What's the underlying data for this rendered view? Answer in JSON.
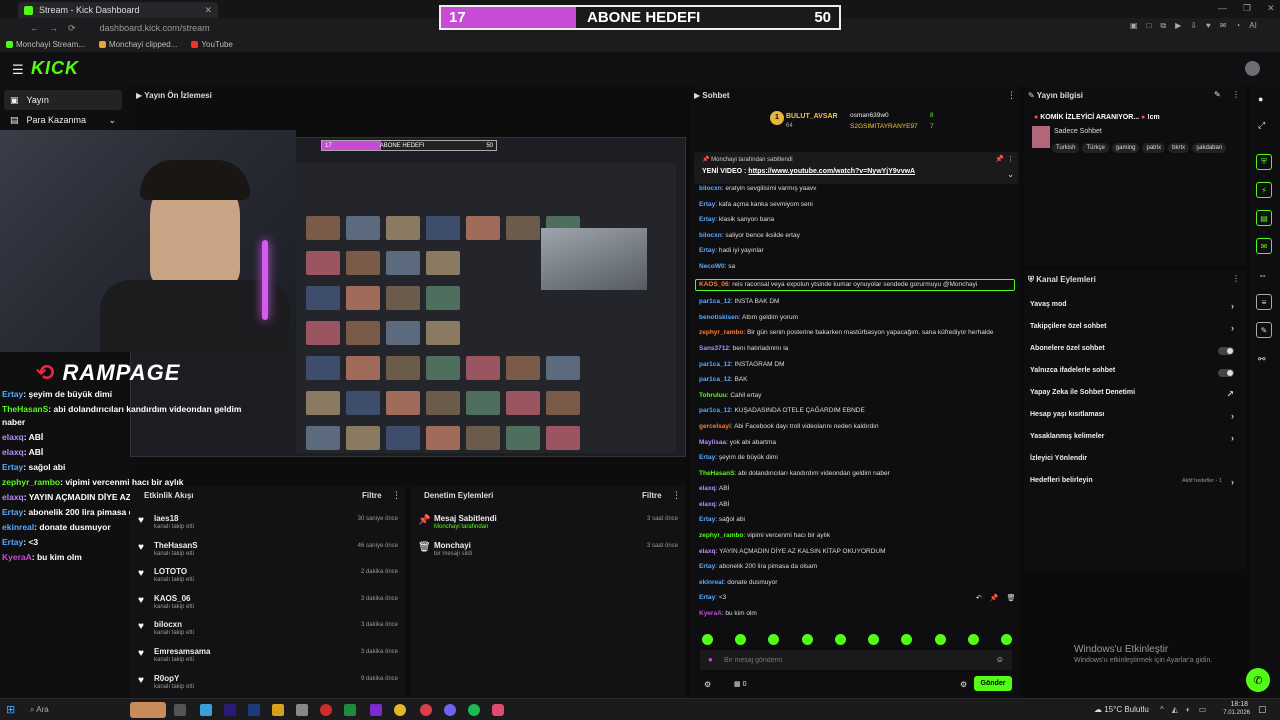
{
  "browser": {
    "tab_title": "Stream - Kick Dashboard",
    "url": "dashboard.kick.com/stream",
    "bookmarks": [
      "Monchayi Stream...",
      "Monchayi clipped...",
      "YouTube"
    ]
  },
  "goal_overlay": {
    "current": "17",
    "title": "ABONE HEDEFI",
    "target": "50",
    "progress": 0.34,
    "fill_color": "#c84bd6"
  },
  "kick": {
    "logo": "KICK",
    "brand_color": "#53fc18"
  },
  "sidebar": {
    "items": [
      {
        "label": "Yayın",
        "icon": "broadcast-icon"
      },
      {
        "label": "Para Kazanma",
        "icon": "money-icon"
      }
    ]
  },
  "preview": {
    "title": "Yayın Ön İzlemesi",
    "mini_goal_current": "17",
    "mini_goal_title": "ABONE HEDEFI",
    "mini_goal_target": "50",
    "rampage_logo": "RAMPAGE"
  },
  "overlay_chat": [
    {
      "name": "Ertay",
      "color": "#57a9ff",
      "text": "şeyim de büyük dimi"
    },
    {
      "name": "TheHasanS",
      "color": "#53fc18",
      "text": "abi dolandırıcıları kandırdım videondan geldim naber"
    },
    {
      "name": "elaxq",
      "color": "#b58bff",
      "text": "ABİ"
    },
    {
      "name": "elaxq",
      "color": "#b58bff",
      "text": "ABİ"
    },
    {
      "name": "Ertay",
      "color": "#57a9ff",
      "text": "sağol abi"
    },
    {
      "name": "zephyr_rambo",
      "color": "#53fc18",
      "text": "vipimi vercenmi hacı bir aylık"
    },
    {
      "name": "elaxq",
      "color": "#b58bff",
      "text": "YAYIN AÇMADIN DİYE AZ KALSIN KİTAP OKUYORDUM"
    },
    {
      "name": "Ertay",
      "color": "#57a9ff",
      "text": "abonelik 200 lira pimasa da olsam"
    },
    {
      "name": "ekinreal",
      "color": "#57a9ff",
      "text": "donate dusmuyor"
    },
    {
      "name": "Ertay",
      "color": "#57a9ff",
      "text": "<3"
    },
    {
      "name": "KyeraA",
      "color": "#c84bd6",
      "text": "bu kim olm"
    }
  ],
  "activity": {
    "title": "Etkinlik Akışı",
    "filter": "Filtre",
    "events": [
      {
        "name": "laes18",
        "sub": "kanalı takip etti",
        "time": "30 saniye önce"
      },
      {
        "name": "TheHasanS",
        "sub": "kanalı takip etti",
        "time": "46 saniye önce"
      },
      {
        "name": "LOTOTO",
        "sub": "kanalı takip etti",
        "time": "2 dakika önce"
      },
      {
        "name": "KAOS_06",
        "sub": "kanalı takip etti",
        "time": "3 dakika önce"
      },
      {
        "name": "bilocxn",
        "sub": "kanalı takip etti",
        "time": "3 dakika önce"
      },
      {
        "name": "Emresamsama",
        "sub": "kanalı takip etti",
        "time": "3 dakika önce"
      },
      {
        "name": "R0opY",
        "sub": "kanalı takip etti",
        "time": "9 dakika önce"
      }
    ]
  },
  "moderation": {
    "title": "Denetim Eylemleri",
    "filter": "Filtre",
    "events": [
      {
        "name": "Mesaj Sabitlendi",
        "sub": "Monchayi tarafından",
        "time": "3 saat önce"
      },
      {
        "name": "Monchayi",
        "sub": "bir mesajı sildi",
        "time": "3 saat önce"
      }
    ]
  },
  "chat": {
    "title": "Sohbet",
    "top_gifters": [
      {
        "name": "BULUT_AVSAR",
        "amount": "64"
      },
      {
        "name": "osman639w0",
        "amount": "8"
      },
      {
        "name": "S2GSIMITAYRANYE97",
        "amount": "7"
      }
    ],
    "pinned_by": "Monchayi tarafından sabitlendi",
    "pinned_text": "YENİ VIDEO : ",
    "pinned_link": "https://www.youtube.com/watch?v=NywYjY9vvwA",
    "messages": [
      {
        "name": "bilocxn",
        "color": "#57a9ff",
        "text": "eratyin sevgilisimi varmış yaavv"
      },
      {
        "name": "Ertay",
        "color": "#57a9ff",
        "text": "kafa açma kanka sevmiyom seni"
      },
      {
        "name": "Ertay",
        "color": "#57a9ff",
        "text": "klasik sanyon bana"
      },
      {
        "name": "bilocxn",
        "color": "#57a9ff",
        "text": "saliyor bence iksilde ertay"
      },
      {
        "name": "Ertay",
        "color": "#57a9ff",
        "text": "hadi iyi yayınlar"
      },
      {
        "name": "NecoW0",
        "color": "#57a9ff",
        "text": "sa"
      },
      {
        "name": "KAOS_06",
        "color": "#ff7a2e",
        "text": "reis raconsal veya expolun ytsinde kumar oynuyolar sendede gorurmuyu @Monchayi",
        "highlight": true
      },
      {
        "name": "par1ca_12",
        "color": "#57a9ff",
        "text": "INSTA BAK DM"
      },
      {
        "name": "benotiskisen",
        "color": "#57a9ff",
        "text": "Attım geldim yorum"
      },
      {
        "name": "zephyr_rambo",
        "color": "#ff7a2e",
        "text": "Bir gün senin posterine bakarken mastürbasyon yapacağım. sana küfrediyor herhalde"
      },
      {
        "name": "Sans3712",
        "color": "#b58bff",
        "text": "benı hatırladınmı la"
      },
      {
        "name": "par1ca_12",
        "color": "#57a9ff",
        "text": "INSTAGRAM DM"
      },
      {
        "name": "par1ca_12",
        "color": "#57a9ff",
        "text": "BAK"
      },
      {
        "name": "Tohruluu",
        "color": "#53fc18",
        "text": "Cahil ertay"
      },
      {
        "name": "par1ca_12",
        "color": "#57a9ff",
        "text": "KUŞADASINDA OTELE ÇAĞARDIM EBNDE"
      },
      {
        "name": "gercelsayi",
        "color": "#ff7a2e",
        "text": "Abi Facebook dayı troll videolarını neden kaldırdın"
      },
      {
        "name": "Maylisaa",
        "color": "#b58bff",
        "text": "yok abi abartma"
      },
      {
        "name": "Ertay",
        "color": "#57a9ff",
        "text": "şeyim de büyük dimi"
      },
      {
        "name": "TheHasanS",
        "color": "#53fc18",
        "text": "abi dolandırıcıları kandırdım videondan geldim naber"
      },
      {
        "name": "elaxq",
        "color": "#b58bff",
        "text": "ABİ"
      },
      {
        "name": "elaxq",
        "color": "#b58bff",
        "text": "ABİ"
      },
      {
        "name": "Ertay",
        "color": "#57a9ff",
        "text": "sağol abi"
      },
      {
        "name": "zephyr_rambo",
        "color": "#53fc18",
        "text": "vipimi vercenmi hacı bir aylık"
      },
      {
        "name": "elaxq",
        "color": "#b58bff",
        "text": "YAYIN AÇMADIN DİYE AZ KALSIN KİTAP OKUYORDUM"
      },
      {
        "name": "Ertay",
        "color": "#57a9ff",
        "text": "abonelik 200 lira pimasa da olsam"
      },
      {
        "name": "ekinreal",
        "color": "#57a9ff",
        "text": "donate dusmuyor"
      },
      {
        "name": "Ertay",
        "color": "#57a9ff",
        "text": "<3"
      },
      {
        "name": "KyeraA",
        "color": "#c84bd6",
        "text": "bu kim olm"
      }
    ],
    "input_placeholder": "Bir mesaj gönderin",
    "send_label": "Gönder",
    "viewer_count": "0"
  },
  "stream_info": {
    "title": "Yayın bilgisi",
    "stream_title": "KOMİK İZLEYİCİ ARANIYOR...",
    "stream_title_suffix": "!cm",
    "category": "Sadece Sohbet",
    "tags": [
      "Turkish",
      "Türkçe",
      "gaming",
      "patrix",
      "bkrtx",
      "şakdaban"
    ]
  },
  "channel_actions": {
    "title": "Kanal Eylemleri",
    "items": [
      {
        "label": "Yavaş mod",
        "kind": "chevron"
      },
      {
        "label": "Takipçilere özel sohbet",
        "kind": "chevron"
      },
      {
        "label": "Abonelere özel sohbet",
        "kind": "toggle"
      },
      {
        "label": "Yalnızca ifadelerle sohbet",
        "kind": "toggle"
      },
      {
        "label": "Yapay Zeka ile Sohbet Denetimi",
        "kind": "external"
      },
      {
        "label": "Hesap yaşı kısıtlaması",
        "kind": "chevron"
      },
      {
        "label": "Yasaklanmış kelimeler",
        "kind": "chevron"
      },
      {
        "label": "İzleyici Yönlendir",
        "kind": "none"
      },
      {
        "label": "Hedefleri belirleyin",
        "kind": "chevron",
        "badge": "Aktif hedefler - 1"
      }
    ]
  },
  "windows_watermark": {
    "line1": "Windows'u Etkinleştir",
    "line2": "Windows'u etkinleştirmek için Ayarlar'a gidin."
  },
  "taskbar": {
    "search": "Ara",
    "weather": "15°C",
    "weather_desc": "Bulutlu",
    "time": "18:18",
    "date": "7.01.2026"
  }
}
